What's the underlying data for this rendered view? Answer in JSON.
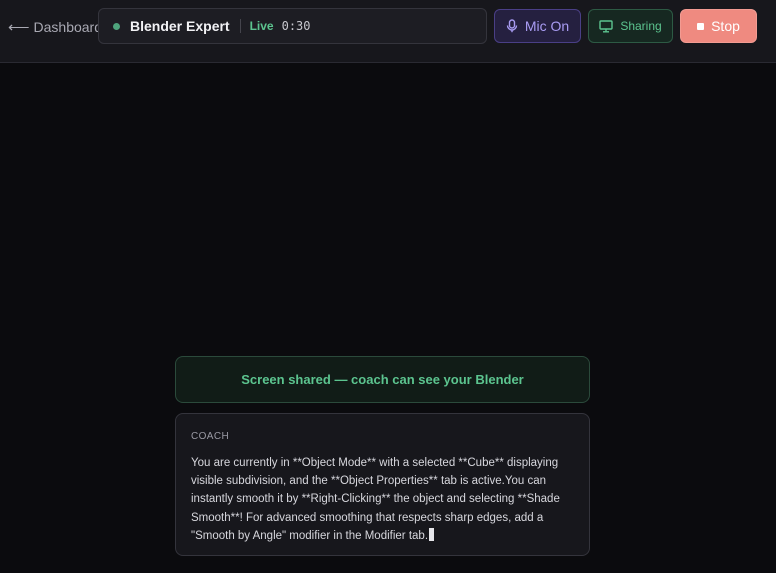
{
  "header": {
    "back_label": "Dashboard",
    "session_title": "Blender Expert",
    "status": "Live",
    "timer": "0:30",
    "mic_label": "Mic On",
    "sharing_label": "Sharing",
    "stop_label": "Stop"
  },
  "banner": {
    "text": "Screen shared — coach can see your Blender"
  },
  "coach": {
    "label": "COACH",
    "message": "You are currently in **Object Mode** with a selected **Cube** displaying visible subdivision, and the **Object Properties** tab is active.You can instantly smooth it by **Right-Clicking** the object and selecting **Shade Smooth**! For advanced smoothing that respects sharp edges, add a \"Smooth by Angle\" modifier in the Modifier tab."
  },
  "colors": {
    "background": "#0b0b0e",
    "live_green": "#5cc48f",
    "mic_purple": "#a99cf3",
    "stop_red": "#ef8a80"
  }
}
